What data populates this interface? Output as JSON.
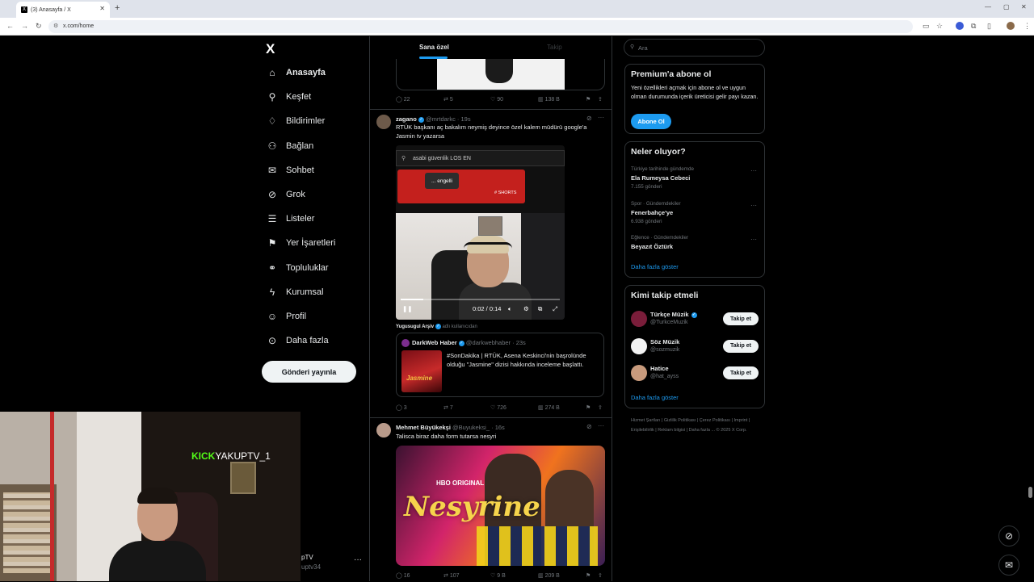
{
  "browser": {
    "tab_title": "(3) Anasayfa / X",
    "tab_icon": "x-logo-icon",
    "url": "x.com/home"
  },
  "nav": {
    "logo": "X",
    "items": [
      {
        "label": "Anasayfa",
        "icon": "home-icon",
        "glyph": "⌂"
      },
      {
        "label": "Keşfet",
        "icon": "search-icon",
        "glyph": "⚲"
      },
      {
        "label": "Bildirimler",
        "icon": "bell-icon",
        "glyph": "♢"
      },
      {
        "label": "Bağlan",
        "icon": "add-user-icon",
        "glyph": "⚇"
      },
      {
        "label": "Sohbet",
        "icon": "mail-icon",
        "glyph": "✉"
      },
      {
        "label": "Grok",
        "icon": "grok-icon",
        "glyph": "⊘"
      },
      {
        "label": "Listeler",
        "icon": "list-icon",
        "glyph": "☰"
      },
      {
        "label": "Yer İşaretleri",
        "icon": "bookmark-icon",
        "glyph": "⚑"
      },
      {
        "label": "Topluluklar",
        "icon": "communities-icon",
        "glyph": "⚭"
      },
      {
        "label": "Kurumsal",
        "icon": "lightning-icon",
        "glyph": "ϟ"
      },
      {
        "label": "Profil",
        "icon": "profile-icon",
        "glyph": "☺"
      },
      {
        "label": "Daha fazla",
        "icon": "more-circle-icon",
        "glyph": "⊙"
      }
    ],
    "post_button": "Gönderi yayınla",
    "account_name": "pTV",
    "account_handle": "uptv34",
    "account_more": "···"
  },
  "stream": {
    "kick_logo": "KICK",
    "channel": "YAKUPTV_1"
  },
  "feed": {
    "tabs": [
      "Sana özel",
      "Takip"
    ],
    "posts": [
      {
        "actions": {
          "reply": "22",
          "repost": "5",
          "like": "90",
          "views": "138 B"
        }
      },
      {
        "name": "zagano",
        "handle": "@mrtdarkc",
        "time": "· 19s",
        "text": "RTÜK başkanı aç bakalım neymiş deyince özel kalem müdürü google'a Jasmin tv yazarsa",
        "video": {
          "search_text": "asabi güvenlik LOS EN",
          "chip": "... engelli",
          "shorts": "# SHORTS",
          "time": "0:02 / 0:14",
          "progress": 0.14
        },
        "attribution_name": "Yugusugul Arşiv",
        "attribution_text": "adlı kullanıcıdan",
        "quote": {
          "name": "DarkWeb Haber",
          "handle": "@darkwebhaber · 23s",
          "text": "#SonDakika | RTÜK, Asena Keskinci'nin başrolünde olduğu \"Jasmine\" dizisi hakkında inceleme başlattı.",
          "thumb_text": "Jasmine"
        },
        "actions": {
          "reply": "3",
          "repost": "7",
          "like": "726",
          "views": "274 B"
        }
      },
      {
        "name": "Mehmet Büyükekşi",
        "handle": "@Buyukeksi_",
        "time": "· 16s",
        "text": "Talisca biraz daha form tutarsa nesyri",
        "image_brand": "HBO ORIGINAL",
        "image_title": "Nesyrine",
        "actions": {
          "reply": "16",
          "repost": "107",
          "like": "9 B",
          "views": "209 B"
        }
      }
    ]
  },
  "sidebar": {
    "search_placeholder": "Ara",
    "premium": {
      "title": "Premium'a abone ol",
      "text": "Yeni özellikleri açmak için abone ol ve uygun olman durumunda içerik üreticisi gelir payı kazan.",
      "button": "Abone Ol"
    },
    "trends": {
      "title": "Neler oluyor?",
      "items": [
        {
          "category": "Türkiye tarihinde gündemde",
          "name": "Ela Rumeysa Cebeci",
          "count": "7.155 gönderi"
        },
        {
          "category": "Spor · Gündemdekiler",
          "name": "Fenerbahçe'ye",
          "count": "6.938 gönderi"
        },
        {
          "category": "Eğlence · Gündemdekiler",
          "name": "Beyazıt Öztürk",
          "count": ""
        }
      ],
      "show_more": "Daha fazla göster"
    },
    "who_to_follow": {
      "title": "Kimi takip etmeli",
      "items": [
        {
          "name": "Türkçe Müzik",
          "handle": "@TurkceMuzik",
          "verified": true,
          "button": "Takip et",
          "avatar_color": "#7a1d3a"
        },
        {
          "name": "Söz Müzik",
          "handle": "@sozmuzik",
          "verified": false,
          "button": "Takip et",
          "avatar_color": "#f2f2f2"
        },
        {
          "name": "Hatice",
          "handle": "@hat_ayss",
          "verified": false,
          "button": "Takip et",
          "avatar_color": "#c89a7c"
        }
      ],
      "show_more": "Daha fazla göster"
    },
    "footer": "Hizmet Şartları  |  Gizlilik Politikası  |  Çerez Politikası  |  Imprint  |  Erişilebilirlik  |  Reklam bilgisi  |  Daha fazla ...  © 2025 X Corp."
  }
}
